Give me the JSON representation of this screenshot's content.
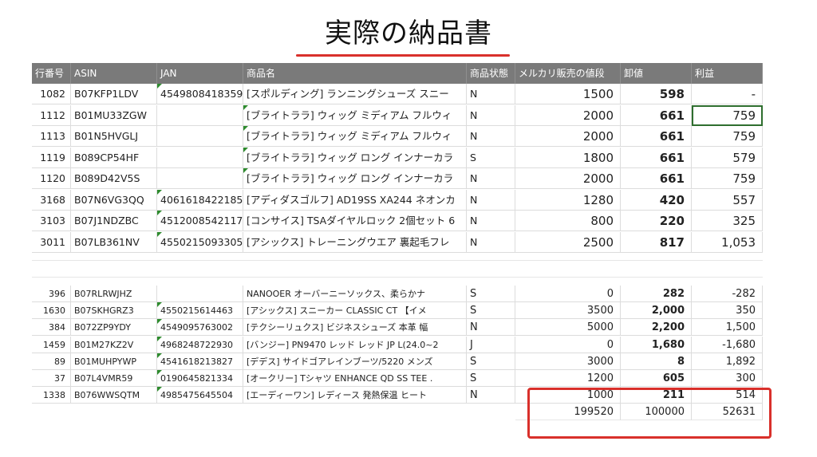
{
  "title": "実際の納品書",
  "headers": {
    "row_no": "行番号",
    "asin": "ASIN",
    "jan": "JAN",
    "name": "商品名",
    "condition": "商品状態",
    "price": "メルカリ販売の値段",
    "cost": "卸値",
    "profit": "利益"
  },
  "rows_top": [
    {
      "no": "1082",
      "asin": "B07KFP1LDV",
      "jan": "4549808418359",
      "name": "[スポルディング] ランニングシューズ スニー",
      "cond": "N",
      "price": "1500",
      "cost": "598",
      "profit": "-"
    },
    {
      "no": "1112",
      "asin": "B01MU33ZGW",
      "jan": "",
      "name": "[ブライトララ] ウィッグ ミディアム フルウィ",
      "cond": "N",
      "price": "2000",
      "cost": "661",
      "profit": "759"
    },
    {
      "no": "1113",
      "asin": "B01N5HVGLJ",
      "jan": "",
      "name": "[ブライトララ] ウィッグ ミディアム フルウィ",
      "cond": "N",
      "price": "2000",
      "cost": "661",
      "profit": "759"
    },
    {
      "no": "1119",
      "asin": "B089CP54HF",
      "jan": "",
      "name": "[ブライトララ] ウィッグ ロング インナーカラ",
      "cond": "S",
      "price": "1800",
      "cost": "661",
      "profit": "579"
    },
    {
      "no": "1120",
      "asin": "B089D42V5S",
      "jan": "",
      "name": "[ブライトララ] ウィッグ ロング インナーカラ",
      "cond": "N",
      "price": "2000",
      "cost": "661",
      "profit": "759"
    },
    {
      "no": "3168",
      "asin": "B07N6VG3QQ",
      "jan": "4061618422185",
      "name": "[アディダスゴルフ] AD19SS XA244 ネオンカ",
      "cond": "N",
      "price": "1280",
      "cost": "420",
      "profit": "557"
    },
    {
      "no": "3103",
      "asin": "B07J1NDZBC",
      "jan": "4512008542117",
      "name": "[コンサイス] TSAダイヤルロック 2個セット 6",
      "cond": "N",
      "price": "800",
      "cost": "220",
      "profit": "325"
    },
    {
      "no": "3011",
      "asin": "B07LB361NV",
      "jan": "4550215093305",
      "name": "[アシックス] トレーニングウエア 裏起毛フレ",
      "cond": "N",
      "price": "2500",
      "cost": "817",
      "profit": "1,053"
    }
  ],
  "rows_bottom": [
    {
      "no": "396",
      "asin": "B07RLRWJHZ",
      "jan": "",
      "name": "NANOOER オーバーニーソックス、柔らかナ",
      "cond": "S",
      "price": "0",
      "cost": "282",
      "profit": "-282"
    },
    {
      "no": "1630",
      "asin": "B07SKHGRZ3",
      "jan": "4550215614463",
      "name": "[アシックス] スニーカー CLASSIC CT 【イメ",
      "cond": "S",
      "price": "3500",
      "cost": "2,000",
      "profit": "350"
    },
    {
      "no": "384",
      "asin": "B072ZP9YDY",
      "jan": "4549095763002",
      "name": "[テクシーリュクス] ビジネスシューズ 本革 幅",
      "cond": "N",
      "price": "5000",
      "cost": "2,200",
      "profit": "1,500"
    },
    {
      "no": "1459",
      "asin": "B01M27KZ2V",
      "jan": "4968248722930",
      "name": "[バンジー] PN9470 レッド レッド JP L(24.0~2",
      "cond": "J",
      "price": "0",
      "cost": "1,680",
      "profit": "-1,680"
    },
    {
      "no": "89",
      "asin": "B01MUHPYWP",
      "jan": "4541618213827",
      "name": "[デデス] サイドゴアレインブーツ/5220 メンズ",
      "cond": "S",
      "price": "3000",
      "cost": "8",
      "profit": "1,892"
    },
    {
      "no": "37",
      "asin": "B07L4VMR59",
      "jan": "0190645821334",
      "name": "[オークリー] Tシャツ ENHANCE QD SS TEE .",
      "cond": "S",
      "price": "1200",
      "cost": "605",
      "profit": "300"
    },
    {
      "no": "1338",
      "asin": "B076WWSQTM",
      "jan": "4985475645504",
      "name": "[エーディーワン] レディース 発熱保温 ヒート",
      "cond": "N",
      "price": "1000",
      "cost": "211",
      "profit": "514"
    }
  ],
  "totals": {
    "price": "199520",
    "cost": "100000",
    "profit": "52631"
  },
  "colors": {
    "accent": "#d9302b",
    "header_bg": "#7a7a7a",
    "marker": "#2e8b2e"
  }
}
